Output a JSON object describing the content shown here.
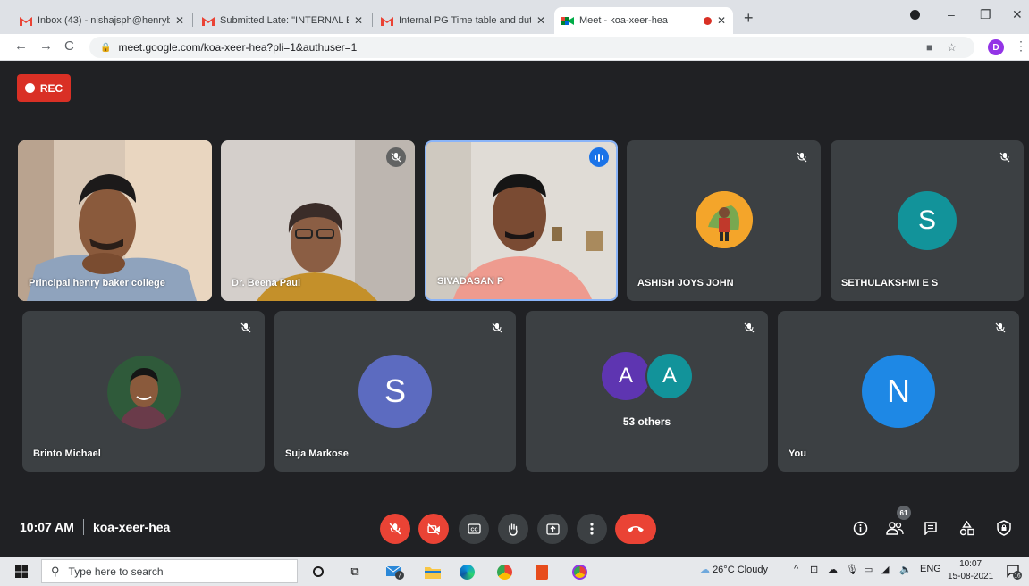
{
  "browser": {
    "tabs": [
      {
        "title": "Inbox (43) - nishajsph@henrybak",
        "favicon": "gmail-icon",
        "active": false
      },
      {
        "title": "Submitted Late: \"INTERNAL EXAI",
        "favicon": "gmail-icon",
        "active": false
      },
      {
        "title": "Internal PG Time table and duty",
        "favicon": "gmail-icon",
        "active": false
      },
      {
        "title": "Meet - koa-xeer-hea",
        "favicon": "meet-icon",
        "active": true
      }
    ],
    "url": "meet.google.com/koa-xeer-hea?pli=1&authuser=1",
    "profile_initial": "D"
  },
  "meet": {
    "rec_label": "REC",
    "tiles": [
      {
        "name": "Principal henry baker college",
        "type": "video"
      },
      {
        "name": "Dr. Beena Paul",
        "type": "video",
        "muted": true
      },
      {
        "name": "SIVADASAN P",
        "type": "video",
        "speaking": true
      },
      {
        "name": "ASHISH JOYS JOHN",
        "type": "photo-avatar",
        "muted": true
      },
      {
        "name": "SETHULAKSHMI E S",
        "type": "letter-avatar",
        "initial": "S",
        "color": "#12939a",
        "muted": true
      },
      {
        "name": "Brinto Michael",
        "type": "photo-avatar",
        "muted": true
      },
      {
        "name": "Suja Markose",
        "type": "letter-avatar",
        "initial": "S",
        "color": "#5c6bc0",
        "muted": true
      },
      {
        "name": "53 others",
        "type": "group",
        "initials": [
          "A",
          "A"
        ],
        "colors": [
          "#5e35b1",
          "#12939a"
        ],
        "muted": true
      },
      {
        "name": "You",
        "type": "letter-avatar",
        "initial": "N",
        "color": "#1e88e5",
        "muted": true
      }
    ],
    "time": "10:07 AM",
    "meeting_code": "koa-xeer-hea",
    "participants_count": "61",
    "controls": [
      "mic-off-icon",
      "camera-off-icon",
      "captions-icon",
      "raise-hand-icon",
      "present-icon",
      "more-options-icon",
      "leave-call-icon"
    ],
    "right_controls": [
      "info-icon",
      "people-icon",
      "chat-icon",
      "activities-icon",
      "host-controls-icon"
    ]
  },
  "taskbar": {
    "search_placeholder": "Type here to search",
    "weather": "26°C  Cloudy",
    "lang": "ENG",
    "time": "10:07",
    "date": "15-08-2021",
    "notification_count": "16",
    "mail_badge": "7"
  }
}
